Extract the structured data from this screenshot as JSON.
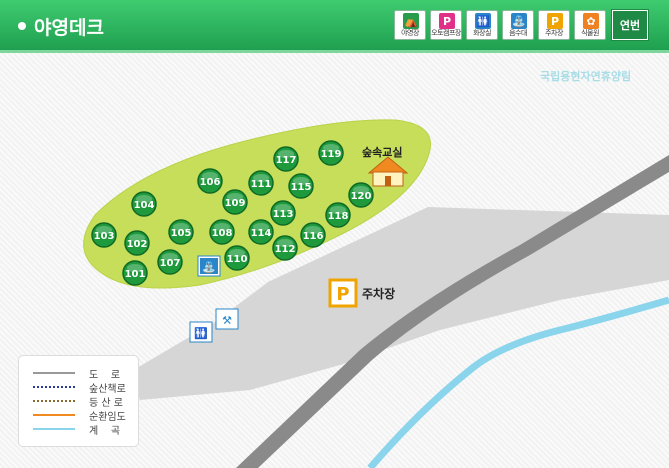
{
  "header": {
    "title": "야영데크"
  },
  "toolbar": [
    {
      "label": "야영장",
      "icon": "tent-icon",
      "color": "#2a9b4a"
    },
    {
      "label": "오토캠프장",
      "icon": "autocamp-icon",
      "color": "#e0308a"
    },
    {
      "label": "화장실",
      "icon": "restroom-icon",
      "color": "#2a86c8"
    },
    {
      "label": "음수대",
      "icon": "water-fountain-icon",
      "color": "#2a86c8"
    },
    {
      "label": "주차장",
      "icon": "parking-icon",
      "color": "#f0a400",
      "glyph": "P"
    },
    {
      "label": "식물원",
      "icon": "botanical-garden-icon",
      "color": "#f08020"
    }
  ],
  "year_button": "연번",
  "forest_name": "국립용현자연휴양림",
  "map": {
    "classroom_label": "숲속교실",
    "parking_label": "주차장",
    "parking_glyph": "P",
    "sites": [
      {
        "id": "101"
      },
      {
        "id": "102"
      },
      {
        "id": "103"
      },
      {
        "id": "104"
      },
      {
        "id": "105"
      },
      {
        "id": "106"
      },
      {
        "id": "107"
      },
      {
        "id": "108"
      },
      {
        "id": "109"
      },
      {
        "id": "110"
      },
      {
        "id": "111"
      },
      {
        "id": "112"
      },
      {
        "id": "113"
      },
      {
        "id": "114"
      },
      {
        "id": "115"
      },
      {
        "id": "116"
      },
      {
        "id": "117"
      },
      {
        "id": "118"
      },
      {
        "id": "119"
      },
      {
        "id": "120"
      }
    ]
  },
  "legend": [
    {
      "label": "도    로",
      "color": "#999999",
      "style": "solid"
    },
    {
      "label": "숲산책로",
      "color": "#2a3d9a",
      "style": "dotted"
    },
    {
      "label": "등 산 로",
      "color": "#8a6a2a",
      "style": "dotted"
    },
    {
      "label": "순환임도",
      "color": "#f08a20",
      "style": "solid"
    },
    {
      "label": "계    곡",
      "color": "#8ad4ec",
      "style": "solid"
    }
  ]
}
